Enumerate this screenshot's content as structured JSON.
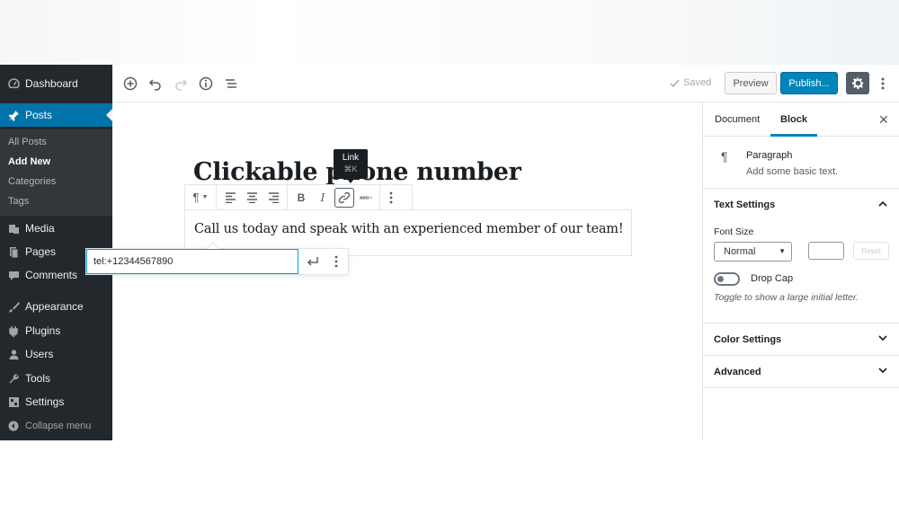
{
  "sidebar": {
    "items": [
      {
        "label": "Dashboard",
        "icon": "dashboard-icon"
      },
      {
        "label": "Posts",
        "icon": "pushpin-icon"
      },
      {
        "label": "Media",
        "icon": "media-icon"
      },
      {
        "label": "Pages",
        "icon": "pages-icon"
      },
      {
        "label": "Comments",
        "icon": "comments-icon"
      },
      {
        "label": "Appearance",
        "icon": "paintbrush-icon"
      },
      {
        "label": "Plugins",
        "icon": "plugins-icon"
      },
      {
        "label": "Users",
        "icon": "users-icon"
      },
      {
        "label": "Tools",
        "icon": "wrench-icon"
      },
      {
        "label": "Settings",
        "icon": "settings-icon"
      }
    ],
    "posts_submenu": [
      "All Posts",
      "Add New",
      "Categories",
      "Tags"
    ],
    "collapse_label": "Collapse menu"
  },
  "toolbar": {
    "saved_label": "Saved",
    "preview_label": "Preview",
    "publish_label": "Publish..."
  },
  "editor": {
    "title": "Clickable phone number",
    "paragraph": "Call us today and speak with an experienced member of our team!",
    "tooltip": {
      "label": "Link",
      "shortcut": "⌘K"
    },
    "link_url": "tel:+12344567890"
  },
  "panel": {
    "tabs": [
      "Document",
      "Block"
    ],
    "active_tab": "Block",
    "block_name": "Paragraph",
    "block_description": "Add some basic text.",
    "text_settings_label": "Text Settings",
    "font_size_label": "Font Size",
    "font_size_value": "Normal",
    "reset_label": "Reset",
    "drop_cap_label": "Drop Cap",
    "drop_cap_help": "Toggle to show a large initial letter.",
    "color_settings_label": "Color Settings",
    "advanced_label": "Advanced"
  },
  "colors": {
    "sidebar_bg": "#23282d",
    "active_menu": "#0073aa",
    "publish": "#0085ba"
  }
}
